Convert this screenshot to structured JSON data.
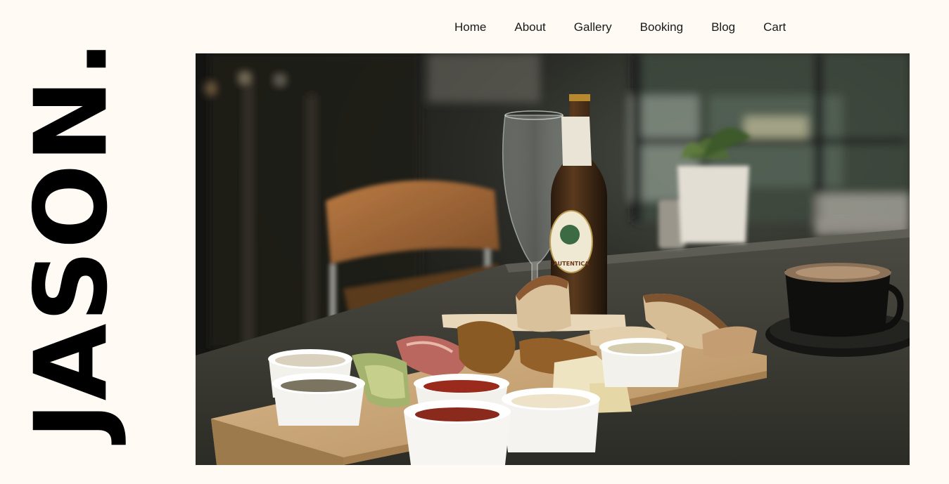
{
  "brand": {
    "logo_text": "JASON."
  },
  "nav": {
    "items": [
      {
        "label": "Home"
      },
      {
        "label": "About"
      },
      {
        "label": "Gallery"
      },
      {
        "label": "Booking"
      },
      {
        "label": "Blog"
      },
      {
        "label": "Cart"
      }
    ]
  },
  "hero": {
    "bottle_label": "AUTENTICA"
  },
  "colors": {
    "background": "#fffaf4",
    "text": "#1a1a1a",
    "logo": "#000000"
  }
}
